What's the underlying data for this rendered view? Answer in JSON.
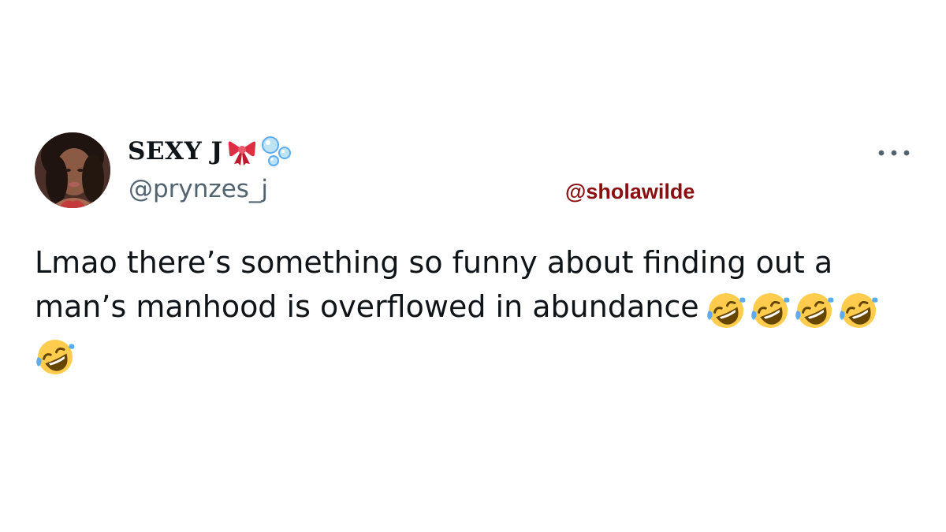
{
  "user": {
    "display_name": "SEXY J",
    "name_emojis": [
      "ribbon-emoji",
      "bubbles-emoji"
    ],
    "handle": "@prynzes_j"
  },
  "watermark": "@sholawilde",
  "tweet": {
    "text_line1": "Lmao there’s something so funny about finding out a",
    "text_line2": "man’s manhood is overflowed in abundance",
    "emojis": [
      "rolling-on-floor-laughing",
      "rolling-on-floor-laughing",
      "rolling-on-floor-laughing",
      "rolling-on-floor-laughing",
      "rolling-on-floor-laughing"
    ]
  },
  "icons": {
    "more": "more-horizontal-icon"
  },
  "colors": {
    "text": "#0f1419",
    "handle": "#536471",
    "watermark": "#8b0f10",
    "background": "#ffffff"
  }
}
